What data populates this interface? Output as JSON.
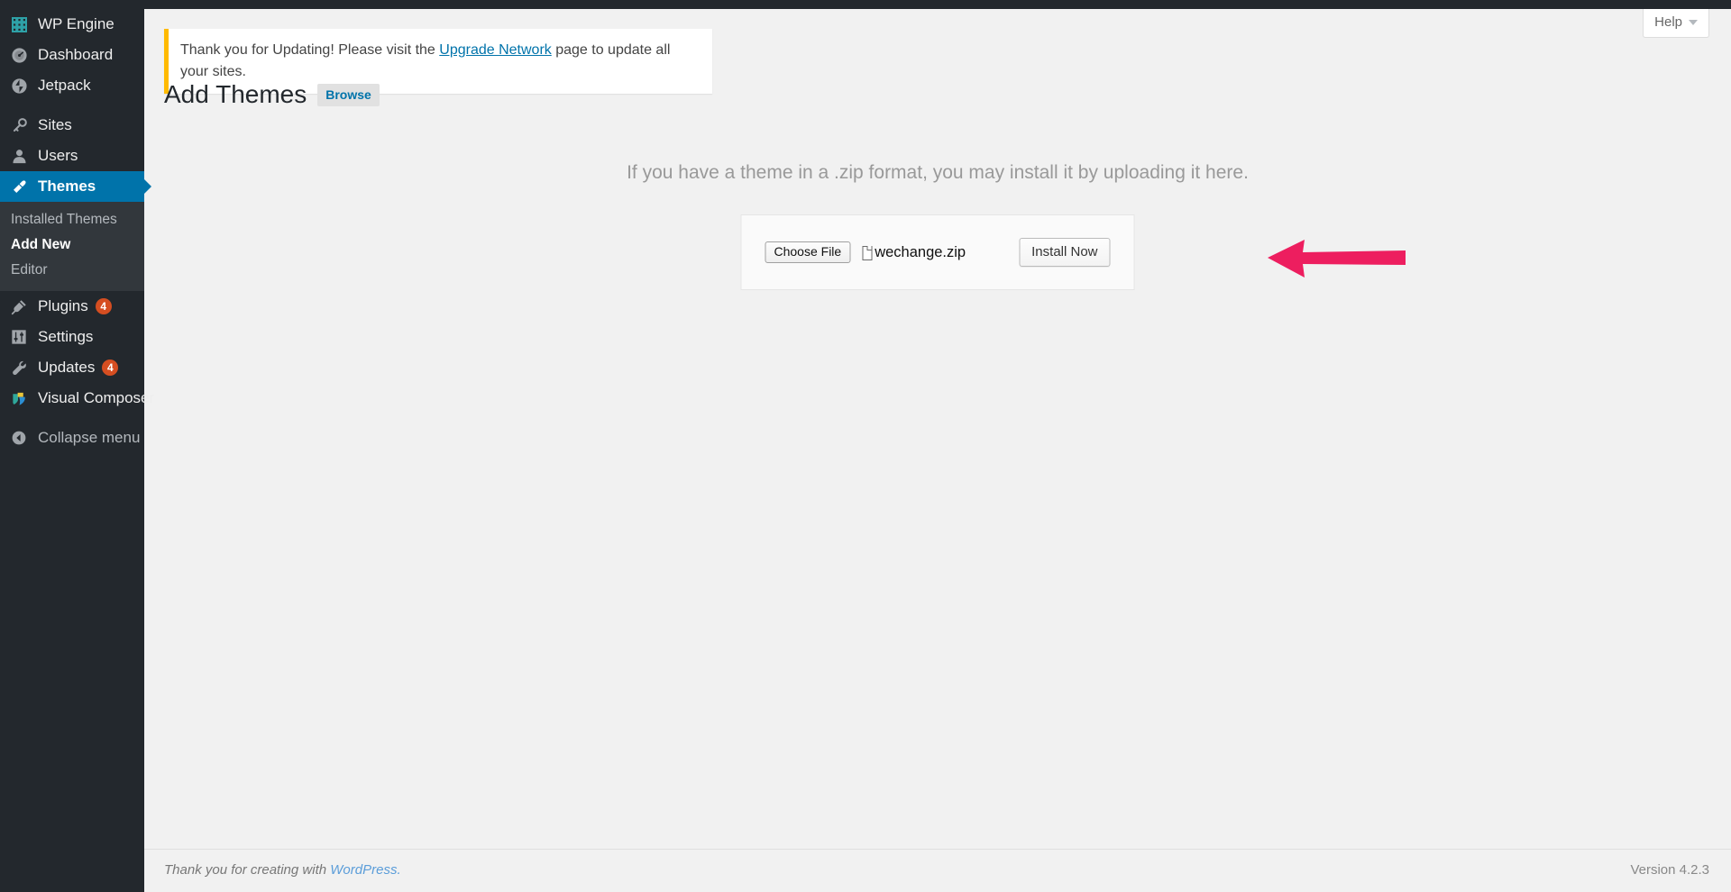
{
  "colors": {
    "sidebar_bg": "#23282d",
    "submenu_bg": "#32373c",
    "accent_blue": "#0073aa",
    "link_blue": "#5b9dd9",
    "badge_orange": "#d54e21",
    "notice_yellow": "#ffba00",
    "arrow_pink": "#ed1e5f",
    "content_bg": "#f1f1f1",
    "wpengine_teal": "#2ea2a8"
  },
  "sidebar": {
    "items": [
      {
        "label": "WP Engine",
        "icon": "grid-icon",
        "badge": "",
        "active": false
      },
      {
        "label": "Dashboard",
        "icon": "dashboard-gauge-icon",
        "badge": "",
        "active": false
      },
      {
        "label": "Jetpack",
        "icon": "jetpack-icon",
        "badge": "",
        "active": false
      },
      {
        "label": "Sites",
        "icon": "key-icon",
        "badge": "",
        "active": false
      },
      {
        "label": "Users",
        "icon": "user-icon",
        "badge": "",
        "active": false
      },
      {
        "label": "Themes",
        "icon": "paintbrush-icon",
        "badge": "",
        "active": true
      },
      {
        "label": "Plugins",
        "icon": "plug-icon",
        "badge": "4",
        "active": false
      },
      {
        "label": "Settings",
        "icon": "settings-sliders-icon",
        "badge": "",
        "active": false
      },
      {
        "label": "Updates",
        "icon": "wrench-icon",
        "badge": "4",
        "active": false
      },
      {
        "label": "Visual Composer",
        "icon": "visual-composer-icon",
        "badge": "",
        "active": false
      },
      {
        "label": "Collapse menu",
        "icon": "collapse-arrow-icon",
        "badge": "",
        "active": false
      }
    ],
    "submenu": [
      {
        "label": "Installed Themes",
        "current": false
      },
      {
        "label": "Add New",
        "current": true
      },
      {
        "label": "Editor",
        "current": false
      }
    ]
  },
  "screen_meta": {
    "help_label": "Help",
    "help_caret": "chevron-down-icon"
  },
  "notice": {
    "text_before": "Thank you for Updating! Please visit the ",
    "link_text": "Upgrade Network",
    "text_after": " page to update all your sites."
  },
  "header": {
    "title": "Add Themes",
    "browse_label": "Browse"
  },
  "upload": {
    "instructions": "If you have a theme in a .zip format, you may install it by uploading it here.",
    "choose_file_label": "Choose File",
    "file_icon": "file-document-icon",
    "file_name": "wechange.zip",
    "install_label": "Install Now"
  },
  "annotation": {
    "arrow_name": "pointer-arrow-to-install-now",
    "arrow_color": "#ed1e5f",
    "direction": "left"
  },
  "footer": {
    "thanks_prefix": "Thank you for creating with ",
    "wordpress_link": "WordPress.",
    "version": "Version 4.2.3"
  }
}
